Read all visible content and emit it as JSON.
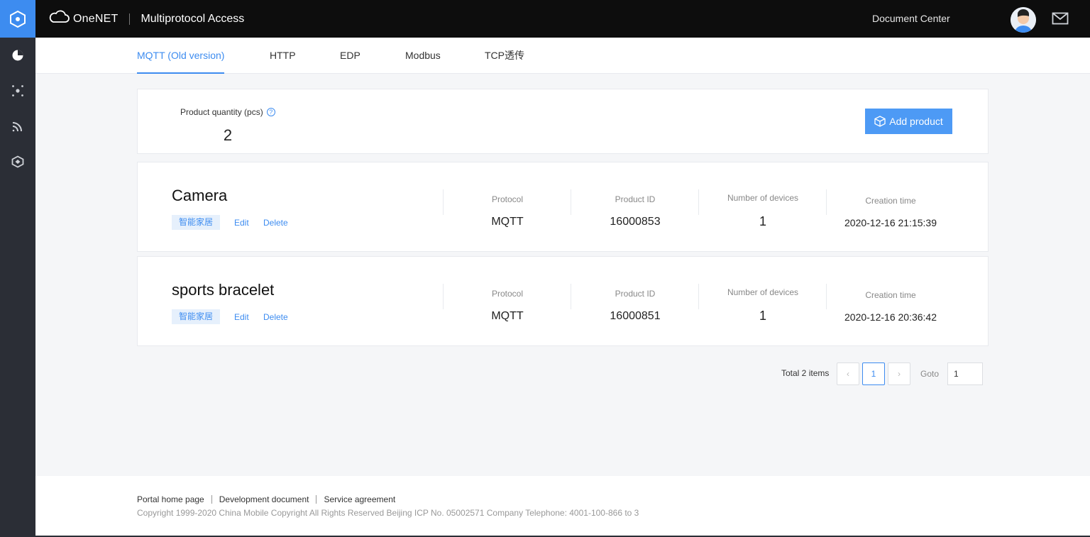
{
  "app": {
    "brand": "OneNET",
    "title": "Multiprotocol Access",
    "doc_center": "Document Center"
  },
  "tabs": [
    {
      "label": "MQTT (Old version)",
      "active": true
    },
    {
      "label": "HTTP",
      "active": false
    },
    {
      "label": "EDP",
      "active": false
    },
    {
      "label": "Modbus",
      "active": false
    },
    {
      "label": "TCP透传",
      "active": false
    }
  ],
  "summary": {
    "label": "Product quantity (pcs)",
    "help": "?",
    "value": "2",
    "add_button": "Add product"
  },
  "products": [
    {
      "name": "Camera",
      "tag": "智能家居",
      "edit": "Edit",
      "delete": "Delete",
      "protocol_label": "Protocol",
      "protocol": "MQTT",
      "id_label": "Product ID",
      "id": "16000853",
      "devices_label": "Number of devices",
      "devices": "1",
      "time_label": "Creation time",
      "time": "2020-12-16 21:15:39"
    },
    {
      "name": "sports bracelet",
      "tag": "智能家居",
      "edit": "Edit",
      "delete": "Delete",
      "protocol_label": "Protocol",
      "protocol": "MQTT",
      "id_label": "Product ID",
      "id": "16000851",
      "devices_label": "Number of devices",
      "devices": "1",
      "time_label": "Creation time",
      "time": "2020-12-16 20:36:42"
    }
  ],
  "pagination": {
    "total": "Total 2 items",
    "prev": "‹",
    "current": "1",
    "next": "›",
    "goto_label": "Goto",
    "goto_value": "1"
  },
  "footer": {
    "links": [
      "Portal home page",
      "Development document",
      "Service agreement"
    ],
    "copyright": "Copyright 1999-2020 China Mobile Copyright All Rights Reserved Beijing ICP No. 05002571 Company Telephone: 4001-100-866 to 3"
  },
  "colors": {
    "accent": "#3d8cf0",
    "topbar": "#0d0d0d",
    "rail": "#2b2e36"
  },
  "icons": {
    "rail": [
      "hexagon-logo-icon",
      "pie-chart-icon",
      "nodes-icon",
      "signal-icon",
      "layers-icon"
    ],
    "topbar": [
      "cloud-logo-icon",
      "avatar",
      "mail-icon"
    ]
  }
}
